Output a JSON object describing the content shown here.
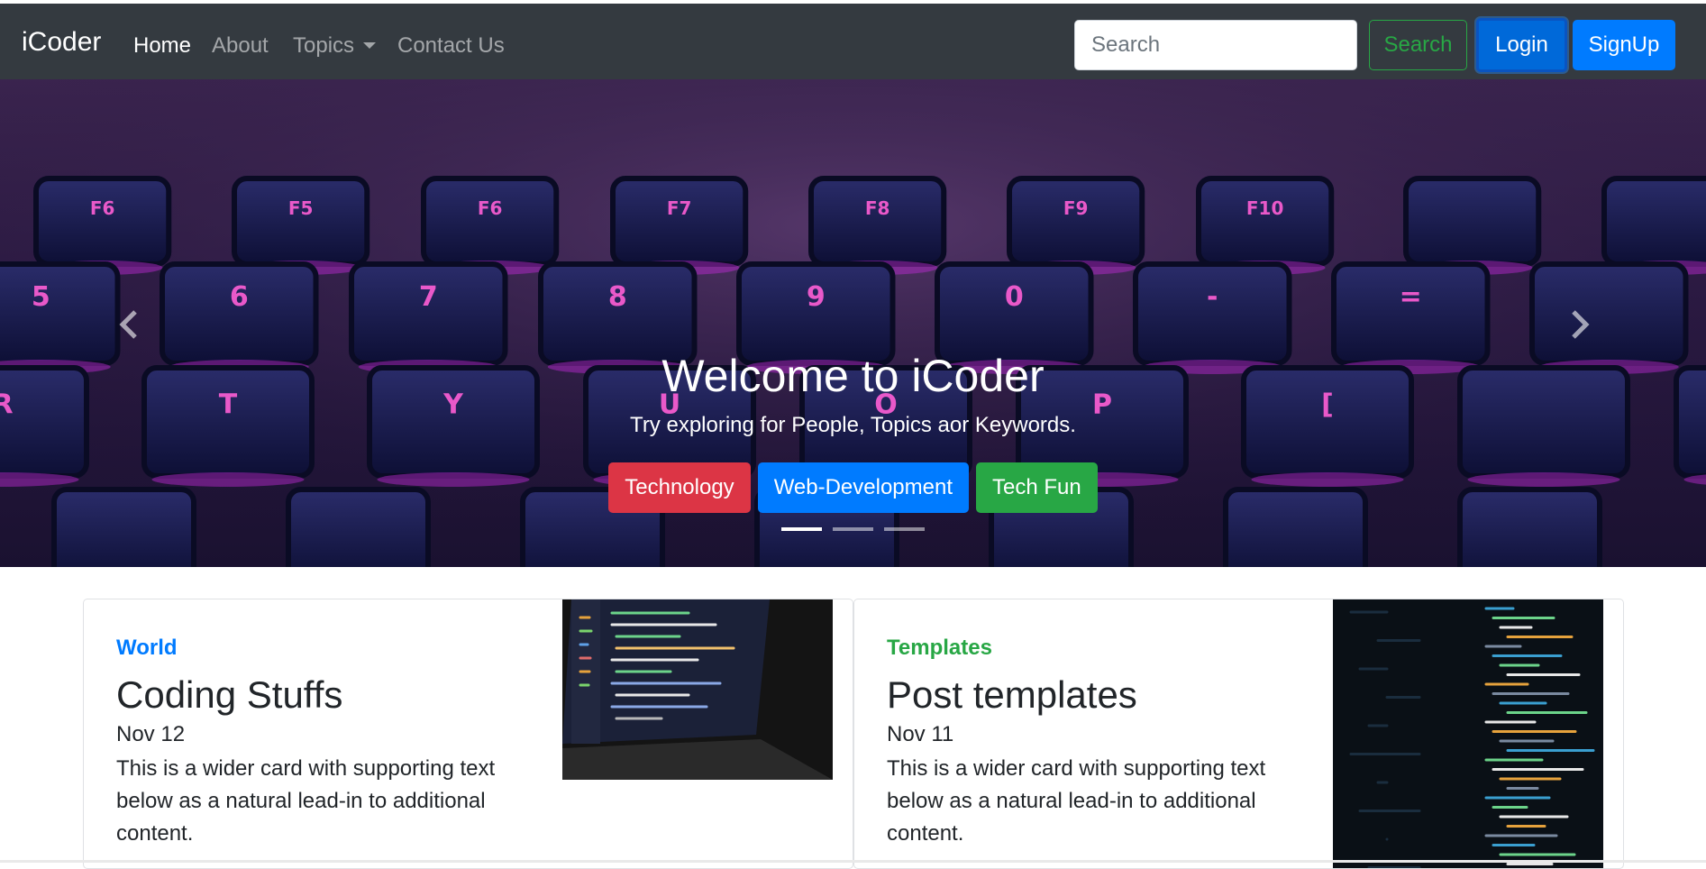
{
  "navbar": {
    "brand": "iCoder",
    "links": [
      {
        "label": "Home",
        "active": true
      },
      {
        "label": "About",
        "active": false
      },
      {
        "label": "Topics",
        "active": false
      },
      {
        "label": "Contact Us",
        "active": false
      }
    ],
    "search_placeholder": "Search",
    "search_button": "Search",
    "login_button": "Login",
    "signup_button": "SignUp"
  },
  "hero": {
    "title": "Welcome to iCoder",
    "subtitle": "Try exploring for People, Topics aor Keywords.",
    "buttons": [
      "Technology",
      "Web-Development",
      "Tech Fun"
    ],
    "active_slide": 1,
    "slide_count": 3,
    "keycaps": [
      "F6",
      "F5",
      "F6",
      "F7",
      "F8",
      "F9",
      "F10",
      "5",
      "6",
      "7",
      "8",
      "9",
      "0",
      "-",
      "=",
      "R",
      "T",
      "Y",
      "U",
      "O",
      "P",
      "["
    ]
  },
  "cards": [
    {
      "category": "World",
      "title": "Coding Stuffs",
      "date": "Nov 12",
      "text": "This is a wider card with supporting text below as a natural lead-in to additional content."
    },
    {
      "category": "Templates",
      "title": "Post templates",
      "date": "Nov 11",
      "text": "This is a wider card with supporting text below as a natural lead-in to additional content."
    }
  ],
  "colors": {
    "navbar_bg": "#343a40",
    "primary": "#007bff",
    "success": "#28a745",
    "danger": "#dc3545"
  }
}
